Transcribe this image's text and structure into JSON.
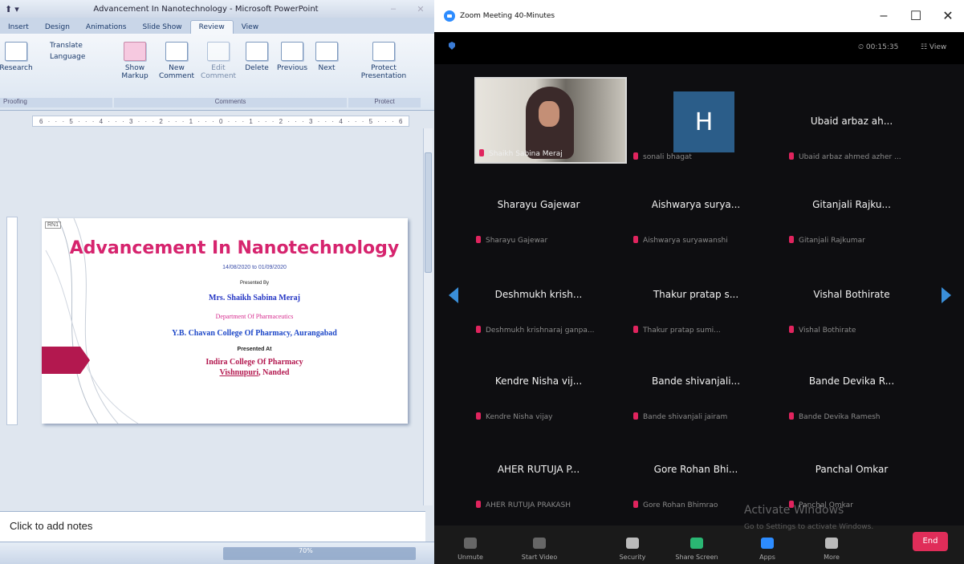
{
  "powerpoint": {
    "quick_access": "⬆ ▾",
    "window_title": "Advancement In Nanotechnology - Microsoft PowerPoint",
    "tabs": [
      {
        "label": "Insert"
      },
      {
        "label": "Design"
      },
      {
        "label": "Animations"
      },
      {
        "label": "Slide Show"
      },
      {
        "label": "Review"
      },
      {
        "label": "View"
      }
    ],
    "active_tab": "Review",
    "ribbon": {
      "research": "Research",
      "translate": "Translate",
      "language": "Language",
      "show_markup": "Show Markup",
      "new_comment": "New Comment",
      "edit_comment": "Edit Comment",
      "delete": "Delete",
      "previous": "Previous",
      "next": "Next",
      "protect_presentation": "Protect Presentation",
      "group_proofing": "Proofing",
      "group_comments": "Comments",
      "group_protect": "Protect"
    },
    "ruler_text": "6 · · · 5 · · · 4 · · · 3 · · · 2 · · · 1 · · · 0 · · · 1 · · · 2 · · · 3 · · · 4 · · · 5 · · · 6",
    "slide": {
      "tag": "RN1",
      "title": "Advancement In Nanotechnology",
      "dates": "14/08/2020 to 01/09/2020",
      "presented_by": "Presented By",
      "presenter": "Mrs. Shaikh Sabina Meraj",
      "department": "Department Of Pharmaceutics",
      "college": "Y.B. Chavan College Of Pharmacy, Aurangabad",
      "presented_at": "Presented At",
      "host_line1": "Indira College Of Pharmacy",
      "host_city": "Vishnupuri",
      "host_suffix": ", Nanded"
    },
    "notes_placeholder": "Click to add notes",
    "zoom_level": "70%"
  },
  "zoom": {
    "window_title": "Zoom Meeting 40-Minutes",
    "meeting_timer": "⏲ 00:15:35",
    "view_label": "☷ View",
    "participants": [
      {
        "display": "",
        "name": "Shaikh Sabina Meraj",
        "video": true
      },
      {
        "display": "H",
        "name": "sonali bhagat",
        "avatar": true
      },
      {
        "display": "Ubaid arbaz ah...",
        "name": "Ubaid arbaz ahmed azher ..."
      },
      {
        "display": "Sharayu Gajewar",
        "name": "Sharayu Gajewar"
      },
      {
        "display": "Aishwarya surya...",
        "name": "Aishwarya suryawanshi"
      },
      {
        "display": "Gitanjali Rajku...",
        "name": "Gitanjali Rajkumar"
      },
      {
        "display": "Deshmukh krish...",
        "name": "Deshmukh krishnaraj ganpa..."
      },
      {
        "display": "Thakur pratap s...",
        "name": "Thakur pratap sumi..."
      },
      {
        "display": "Vishal Bothirate",
        "name": "Vishal Bothirate"
      },
      {
        "display": "Kendre Nisha vij...",
        "name": "Kendre Nisha vijay"
      },
      {
        "display": "Bande shivanjali...",
        "name": "Bande shivanjali jairam"
      },
      {
        "display": "Bande Devika R...",
        "name": "Bande Devika Ramesh"
      },
      {
        "display": "AHER RUTUJA P...",
        "name": "AHER RUTUJA PRAKASH"
      },
      {
        "display": "Gore Rohan Bhi...",
        "name": "Gore Rohan Bhimrao"
      },
      {
        "display": "Panchal Omkar",
        "name": "Panchal Omkar"
      }
    ],
    "controls": {
      "unmute": "Unmute",
      "start_video": "Start Video",
      "security": "Security",
      "share_screen": "Share Screen",
      "apps": "Apps",
      "more": "More",
      "end": "End"
    },
    "watermark_title": "Activate Windows",
    "watermark_sub": "Go to Settings to activate Windows.",
    "colors": {
      "background": "#0e0e11",
      "end_button": "#e02d59",
      "nav_arrow": "#3a8fd9",
      "muted_mic": "#e0245e",
      "avatar": "#2b5d89"
    }
  }
}
